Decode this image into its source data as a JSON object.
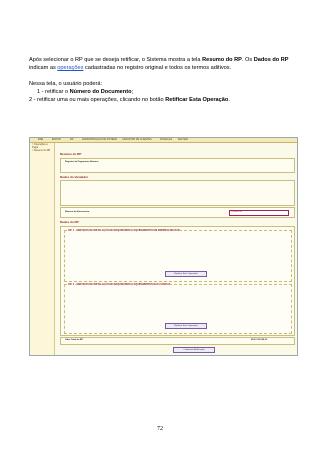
{
  "intro": {
    "line1_a": "Após selecionar o RP que se deseja retificar, o Sistema mostra a tela ",
    "line1_b": "Resumo do RP",
    "line1_c": ". Os ",
    "line1_d": "Dados do RP",
    "line2_a": "indicam as ",
    "line2_link": "operações",
    "line2_b": " cadastradas no registro original e todos os termos aditivos."
  },
  "options": {
    "heading": "Nessa tela, o usuário poderá:",
    "item1_a": "1 - retificar o ",
    "item1_b": "Número do Documento",
    "item1_c": ";",
    "item2_a": "2 - retificar uma ou mais operações, clicando no botão ",
    "item2_b": "Retificar Esta Operação",
    "item2_c": "."
  },
  "screenshot": {
    "menu": [
      "RDE",
      "EDITAR",
      "RP",
      "ADMINISTRAÇÃO DE SISTEMA",
      "CADASTRO DE CLIENTES",
      "FINANÇAS",
      "FECHAR"
    ],
    "sidebar": [
      "> Operações a Pagar",
      "> Resumo do RP"
    ],
    "page_title": "Resumo do RP",
    "sections": {
      "top_title": "Registro de Pagamento Número",
      "doc_title": "Dados do Vendedor",
      "doc_number_label": "Número do Documento",
      "doc_number_value": "123456789",
      "rp_data_title": "Dados do RP",
      "op1_title": "OP: 1 - SERVIÇOS DE INSTALAÇÃO DE MAQUINÁRIOS E EQUIPAMENTOS EM EMPRESA MILITAR",
      "op2_title": "OP: 2 - SERVIÇOS DE INSTALAÇÃO DE MAQUINÁRIOS E EQUIPAMENTOS NAS CLÍNICAS",
      "total_label": "Valor Total do RP",
      "total_value": "EUR 124.508,00"
    },
    "buttons": {
      "retify_op1": "Retificar Esta Operação",
      "retify_op2": "Retificar Esta Operação",
      "confirm": "Confirmar Retificação"
    }
  },
  "page_number": "72"
}
